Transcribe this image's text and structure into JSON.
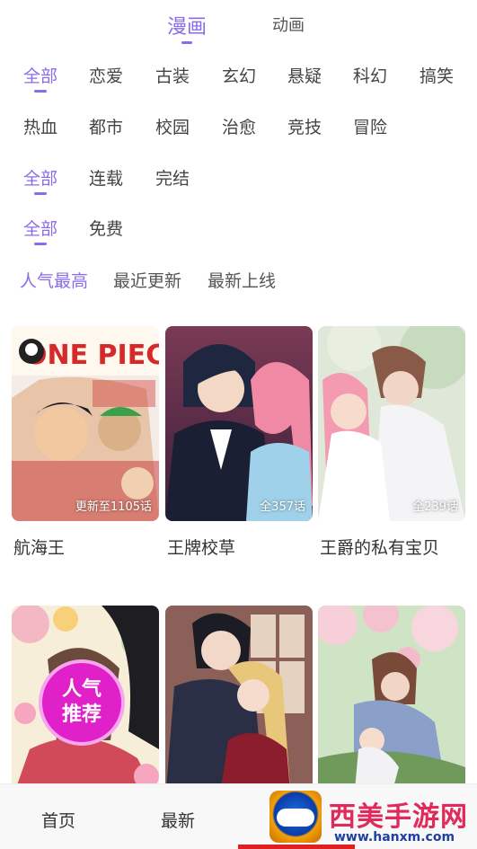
{
  "top_tabs": [
    {
      "label": "漫画",
      "active": true
    },
    {
      "label": "动画",
      "active": false
    }
  ],
  "genres_row1": [
    "全部",
    "恋爱",
    "古装",
    "玄幻",
    "悬疑",
    "科幻",
    "搞笑"
  ],
  "genres_row2": [
    "热血",
    "都市",
    "校园",
    "治愈",
    "竞技",
    "冒险"
  ],
  "status_filters": [
    "全部",
    "连载",
    "完结"
  ],
  "price_filters": [
    "全部",
    "免费"
  ],
  "sort_options": [
    "人气最高",
    "最近更新",
    "最新上线"
  ],
  "comics": [
    {
      "title": "航海王",
      "episodes": "更新至1105话"
    },
    {
      "title": "王牌校草",
      "episodes": "全357话"
    },
    {
      "title": "王爵的私有宝贝",
      "episodes": "全239话"
    },
    {
      "title": "",
      "episodes": ""
    },
    {
      "title": "",
      "episodes": ""
    },
    {
      "title": "",
      "episodes": ""
    }
  ],
  "badge": {
    "line1": "人气",
    "line2": "推荐"
  },
  "bottom_nav": [
    "首页",
    "最新"
  ],
  "watermark": {
    "text": "西美手游网",
    "url": "www.hanxm.com"
  },
  "colors": {
    "accent": "#8a6be8",
    "nav_active": "#e02020",
    "badge": "#e020c8"
  }
}
